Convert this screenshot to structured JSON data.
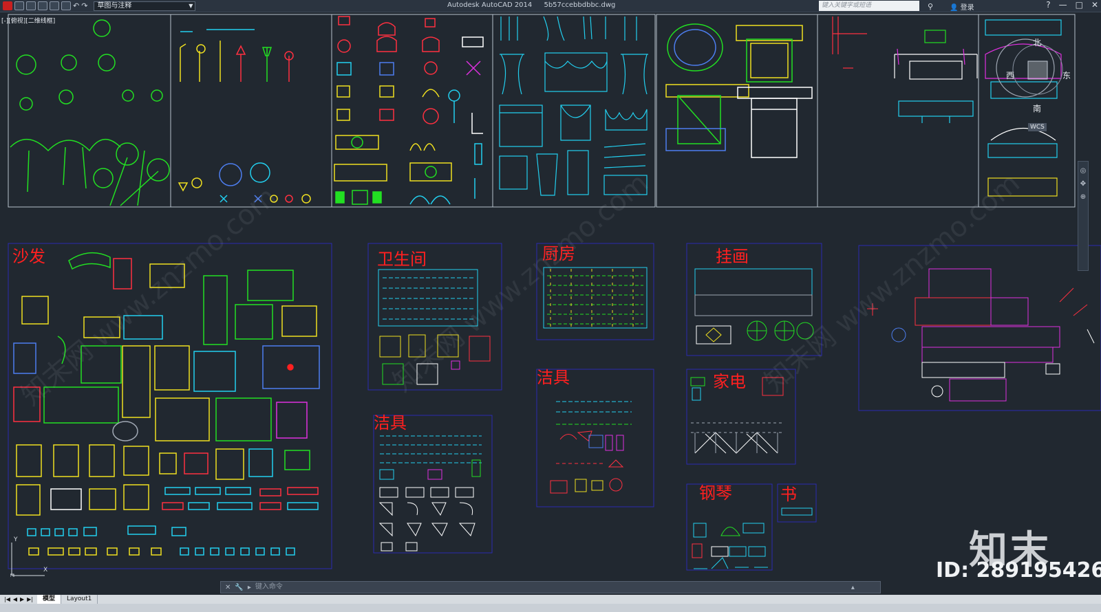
{
  "titlebar": {
    "workspace": "草图与注释",
    "app_title": "Autodesk AutoCAD 2014",
    "file_name": "5b57ccebbdbbc.dwg",
    "search_placeholder": "键入关键字或短语",
    "login": "登录"
  },
  "viewport": {
    "label": "[-][俯视][二维线框]"
  },
  "blocks": [
    {
      "label": "沙发"
    },
    {
      "label": "卫生间"
    },
    {
      "label": "厨房"
    },
    {
      "label": "挂画"
    },
    {
      "label": "洁具"
    },
    {
      "label": "洁具"
    },
    {
      "label": "家电"
    },
    {
      "label": "钢琴"
    },
    {
      "label": "书"
    }
  ],
  "compass": {
    "north": "北",
    "south": "南",
    "east": "东",
    "west": "西",
    "wcs": "WCS"
  },
  "commandline": {
    "placeholder": "键入命令"
  },
  "tabs": {
    "model": "模型",
    "layout1": "Layout1"
  },
  "status": {
    "coords": ""
  },
  "watermark": {
    "brand": "知末",
    "id": "ID: 289195426",
    "site": "知末网 www.znzmo.com"
  },
  "colors": {
    "background": "#212830",
    "label": "#ff2020",
    "frame": "#2a2ab0",
    "panel_border": "#b8c2cc"
  }
}
